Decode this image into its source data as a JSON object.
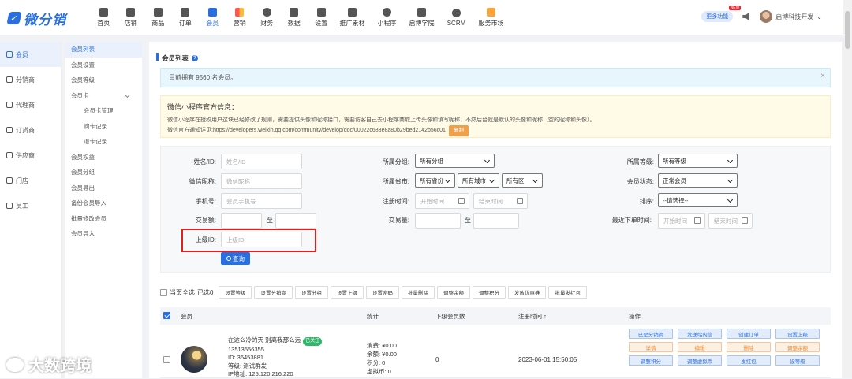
{
  "brand": {
    "name": "微分销"
  },
  "nav": [
    {
      "label": "首页",
      "icon": "home-icon"
    },
    {
      "label": "店铺",
      "icon": "store-icon"
    },
    {
      "label": "商品",
      "icon": "goods-icon"
    },
    {
      "label": "订单",
      "icon": "order-icon"
    },
    {
      "label": "会员",
      "icon": "member-icon",
      "active": true
    },
    {
      "label": "营销",
      "icon": "marketing-icon"
    },
    {
      "label": "财务",
      "icon": "finance-icon"
    },
    {
      "label": "数据",
      "icon": "data-icon"
    },
    {
      "label": "设置",
      "icon": "settings-icon"
    },
    {
      "label": "推广素材",
      "icon": "share-icon"
    },
    {
      "label": "小程序",
      "icon": "miniapp-icon"
    },
    {
      "label": "启博学院",
      "icon": "academy-icon"
    },
    {
      "label": "SCRM",
      "icon": "scrm-icon"
    },
    {
      "label": "服务市场",
      "icon": "market-icon"
    }
  ],
  "topright": {
    "more_label": "更多功能",
    "new_badge": "NEW",
    "user_name": "启博科技开发"
  },
  "side1": [
    {
      "label": "会员",
      "active": true
    },
    {
      "label": "分销商"
    },
    {
      "label": "代理商"
    },
    {
      "label": "订货商"
    },
    {
      "label": "供应商"
    },
    {
      "label": "门店"
    },
    {
      "label": "员工"
    }
  ],
  "side2": [
    {
      "label": "会员列表",
      "active": true
    },
    {
      "label": "会员设置"
    },
    {
      "label": "会员等级"
    },
    {
      "label": "会员卡"
    },
    {
      "label": "会员卡管理",
      "sub": true
    },
    {
      "label": "购卡记录",
      "sub": true
    },
    {
      "label": "退卡记录",
      "sub": true
    },
    {
      "label": "会员权益"
    },
    {
      "label": "会员分组"
    },
    {
      "label": "会员导出"
    },
    {
      "label": "备份会员导入"
    },
    {
      "label": "批量修改会员"
    },
    {
      "label": "会员导入"
    }
  ],
  "page": {
    "title": "会员列表",
    "info": "目前拥有 9560 名会员。",
    "warn_title": "微信小程序官方信息：",
    "warn_line1": "微信小程序在授权用户这块已经修改了规则，需要提供头像和昵称接口，需要访客自己去小程序商城上传头像和填写昵称，不然后台就是默认的头像和昵称（空的昵称和头像）。",
    "warn_line2": "微信官方通知详见:https://developers.weixin.qq.com/community/develop/doc/00022c683e8a80b29bed2142b56c01",
    "copy_label": "复制"
  },
  "filters": {
    "name_label": "姓名/ID:",
    "name_ph": "姓名/ID",
    "nick_label": "微信昵称:",
    "nick_ph": "微信昵称",
    "phone_label": "手机号:",
    "phone_ph": "会员手机号",
    "trade_amount_label": "交易额:",
    "to": "至",
    "parent_label": "上级ID:",
    "parent_ph": "上级ID",
    "group_label": "所属分组:",
    "group_value": "所有分组",
    "region_label": "所属省市:",
    "province": "所有省份",
    "city": "所有城市",
    "district": "所有区",
    "reg_time_label": "注册时间:",
    "start_ph": "开始时间",
    "end_ph": "结束时间",
    "trade_qty_label": "交易量:",
    "level_label": "所属等级:",
    "level_value": "所有等级",
    "status_label": "会员状态:",
    "status_value": "正常会员",
    "sort_label": "排序:",
    "sort_value": "--请选择--",
    "last_order_label": "最近下单时间:",
    "search_label": "查询"
  },
  "bulk": {
    "select_all": "当页全选",
    "selected": "已选0",
    "buttons": [
      "设置等级",
      "设置分销商",
      "设置分组",
      "设置上级",
      "设置密码",
      "批量删除",
      "调整余额",
      "调整积分",
      "发放优惠券",
      "批量发红包"
    ]
  },
  "table": {
    "headers": {
      "member": "会员",
      "stats": "统计",
      "sub_count": "下级会员数",
      "reg_time": "注册时间 ↕",
      "ops": "操作"
    },
    "rows": [
      {
        "nickname": "在这么冷的天 别离我那么远",
        "follow_tag": "已关注",
        "phone": "13513556355",
        "id": "ID: 36453881",
        "level": "等级: 测试群发",
        "ip": "IP地址: 125.120.216.220",
        "consume": "消费: ¥0.00",
        "balance": "余额: ¥0.00",
        "points": "积分: 0",
        "virtual": "虚拟币: 0",
        "sub_count": "0",
        "reg_time": "2023-06-01 15:50:05",
        "ops": [
          {
            "label": "已是分销商",
            "style": "blue"
          },
          {
            "label": "发送站内信",
            "style": "blue"
          },
          {
            "label": "创建订单",
            "style": "blue"
          },
          {
            "label": "设置上级",
            "style": "blue"
          },
          {
            "label": "详情",
            "style": "orange"
          },
          {
            "label": "编辑",
            "style": "orange"
          },
          {
            "label": "删除",
            "style": "orange"
          },
          {
            "label": "调整余额",
            "style": "orange"
          },
          {
            "label": "调整积分",
            "style": "blue"
          },
          {
            "label": "调整虚拟币",
            "style": "blue"
          },
          {
            "label": "发红包",
            "style": "blue"
          },
          {
            "label": "设等级",
            "style": "blue"
          }
        ]
      }
    ]
  },
  "watermark": "大数跨境"
}
